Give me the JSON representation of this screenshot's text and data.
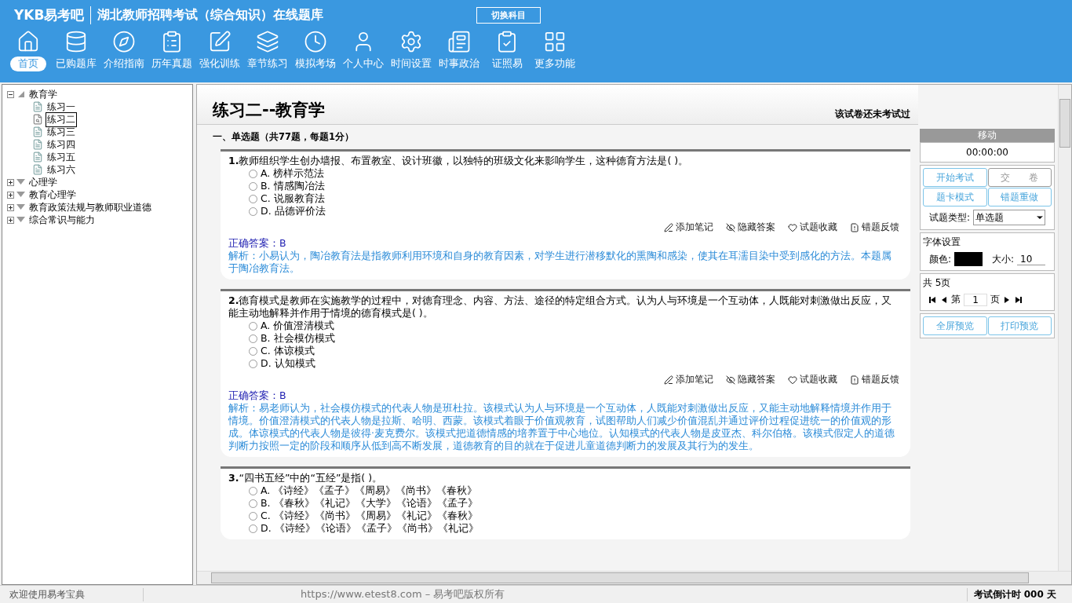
{
  "header": {
    "logo": "YKB易考吧",
    "title": "湖北教师招聘考试（综合知识）在线题库",
    "switch_button": "切换科目"
  },
  "toolbar": [
    {
      "label": "首页",
      "selected": true
    },
    {
      "label": "已购题库",
      "selected": false
    },
    {
      "label": "介绍指南",
      "selected": false
    },
    {
      "label": "历年真题",
      "selected": false
    },
    {
      "label": "强化训练",
      "selected": false
    },
    {
      "label": "章节练习",
      "selected": false
    },
    {
      "label": "模拟考场",
      "selected": false
    },
    {
      "label": "个人中心",
      "selected": false
    },
    {
      "label": "时间设置",
      "selected": false
    },
    {
      "label": "时事政治",
      "selected": false
    },
    {
      "label": "证照易",
      "selected": false
    },
    {
      "label": "更多功能",
      "selected": false
    }
  ],
  "tree": [
    {
      "label": "教育学",
      "expanded": true,
      "children": [
        {
          "label": "练习一",
          "selected": false
        },
        {
          "label": "练习二",
          "selected": true
        },
        {
          "label": "练习三",
          "selected": false
        },
        {
          "label": "练习四",
          "selected": false
        },
        {
          "label": "练习五",
          "selected": false
        },
        {
          "label": "练习六",
          "selected": false
        }
      ]
    },
    {
      "label": "心理学",
      "expanded": false
    },
    {
      "label": "教育心理学",
      "expanded": false
    },
    {
      "label": "教育政策法规与教师职业道德",
      "expanded": false
    },
    {
      "label": "综合常识与能力",
      "expanded": false
    }
  ],
  "paper": {
    "title": "练习二--教育学",
    "status": "该试卷还未考试过",
    "section": "一、单选题（共77题，每题1分）"
  },
  "questions": [
    {
      "number": "1.",
      "text": "教师组织学生创办墙报、布置教室、设计班徽，以独特的班级文化来影响学生，这种德育方法是(  )。",
      "options": [
        {
          "text": "A. 榜样示范法",
          "selected": false
        },
        {
          "text": "B. 情感陶冶法",
          "selected": false
        },
        {
          "text": "C. 说服教育法",
          "selected": false
        },
        {
          "text": "D. 品德评价法",
          "selected": false
        }
      ],
      "actions": [
        "添加笔记",
        "隐藏答案",
        "试题收藏",
        "错题反馈"
      ],
      "answer": "正确答案：B",
      "explanation": "解析：小易认为，陶冶教育法是指教师利用环境和自身的教育因素，对学生进行潜移默化的熏陶和感染，使其在耳濡目染中受到感化的方法。本题属于陶冶教育法。"
    },
    {
      "number": "2.",
      "text": "德育模式是教师在实施教学的过程中，对德育理念、内容、方法、途径的特定组合方式。认为人与环境是一个互动体，人既能对刺激做出反应，又能主动地解释并作用于情境的德育模式是(  )。",
      "options": [
        {
          "text": "A. 价值澄清模式",
          "selected": false
        },
        {
          "text": "B. 社会模仿模式",
          "selected": false
        },
        {
          "text": "C. 体谅模式",
          "selected": false
        },
        {
          "text": "D. 认知模式",
          "selected": false
        }
      ],
      "actions": [
        "添加笔记",
        "隐藏答案",
        "试题收藏",
        "错题反馈"
      ],
      "answer": "正确答案：B",
      "explanation": "解析：易老师认为，社会模仿模式的代表人物是班杜拉。该模式认为人与环境是一个互动体，人既能对刺激做出反应，又能主动地解释情境并作用于情境。价值澄清模式的代表人物是拉斯、哈明、西蒙。该模式着眼于价值观教育，试图帮助人们减少价值混乱并通过评价过程促进统一的价值观的形成。体谅模式的代表人物是彼得·麦克费尔。该模式把道德情感的培养置于中心地位。认知模式的代表人物是皮亚杰、科尔伯格。该模式假定人的道德判断力按照一定的阶段和顺序从低到高不断发展，道德教育的目的就在于促进儿童道德判断力的发展及其行为的发生。"
    },
    {
      "number": "3.",
      "text": "“四书五经”中的“五经”是指(  )。",
      "options": [
        {
          "text": "A. 《诗经》《孟子》《周易》《尚书》《春秋》",
          "selected": false
        },
        {
          "text": "B. 《春秋》《礼记》《大学》《论语》《孟子》",
          "selected": false
        },
        {
          "text": "C. 《诗经》《尚书》《周易》《礼记》《春秋》",
          "selected": false
        },
        {
          "text": "D. 《诗经》《论语》《孟子》《尚书》《礼记》",
          "selected": false
        }
      ]
    }
  ],
  "panel": {
    "header": "移动",
    "timer": "00:00:00",
    "buttons": [
      {
        "label": "开始考试",
        "disabled": false
      },
      {
        "label": "交　　卷",
        "disabled": true
      },
      {
        "label": "题卡模式",
        "disabled": false
      },
      {
        "label": "错题重做",
        "disabled": false
      }
    ],
    "type_label": "试题类型:",
    "type_value": "单选题",
    "font_group": "字体设置",
    "color_label": "颜色:",
    "color": "#000000",
    "size_label": "大小:",
    "size_value": "10",
    "page_group": "共 5页",
    "page_prefix": "第",
    "page_value": "1",
    "page_suffix": "页",
    "bottom_buttons": [
      "全屏预览",
      "打印预览"
    ]
  },
  "status_bar": {
    "welcome": "欢迎使用易考宝典",
    "copyright": "https://www.etest8.com – 易考吧版权所有",
    "countdown": "考试倒计时 000 天"
  }
}
